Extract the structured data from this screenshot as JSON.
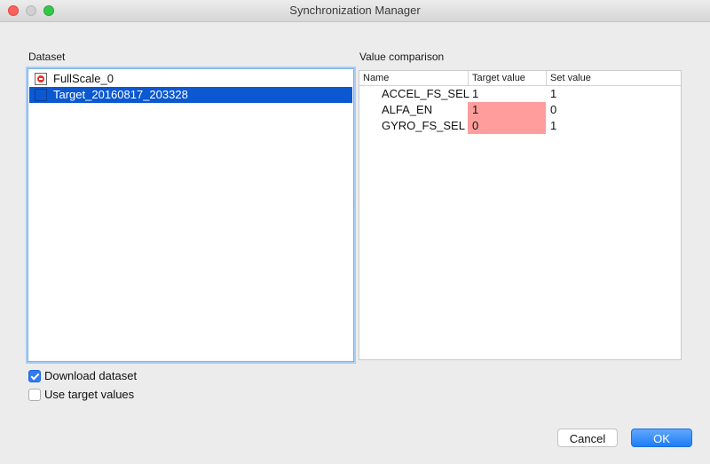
{
  "window": {
    "title": "Synchronization Manager"
  },
  "dataset": {
    "label": "Dataset",
    "items": [
      {
        "label": "FullScale_0",
        "icon": "error-icon",
        "selected": false
      },
      {
        "label": "Target_20160817_203328",
        "icon": "blank-icon",
        "selected": true
      }
    ]
  },
  "comparison": {
    "label": "Value comparison",
    "columns": [
      "Name",
      "Target value",
      "Set value"
    ],
    "rows": [
      {
        "name": "ACCEL_FS_SEL",
        "target": "1",
        "set": "1",
        "mismatch": false
      },
      {
        "name": "ALFA_EN",
        "target": "1",
        "set": "0",
        "mismatch": true
      },
      {
        "name": "GYRO_FS_SEL",
        "target": "0",
        "set": "1",
        "mismatch": true
      }
    ]
  },
  "options": {
    "download_dataset": {
      "label": "Download dataset",
      "checked": true
    },
    "use_target_values": {
      "label": "Use target values",
      "checked": false
    }
  },
  "buttons": {
    "cancel": "Cancel",
    "ok": "OK"
  },
  "colors": {
    "selection": "#0b58d0",
    "mismatch": "#ff9d9d",
    "accent": "#1d7ef8"
  }
}
